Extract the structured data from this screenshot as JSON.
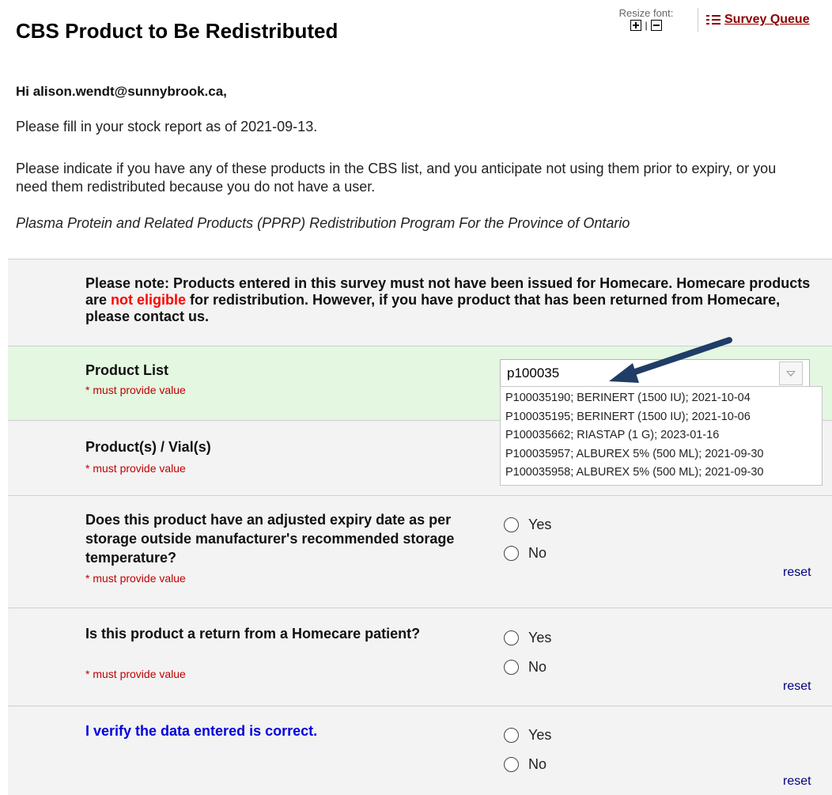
{
  "header": {
    "title": "CBS Product to Be Redistributed",
    "resize_font_label": "Resize font:",
    "resize_separator": "|",
    "survey_queue_label": "Survey Queue"
  },
  "intro": {
    "greeting": "Hi alison.wendt@sunnybrook.ca,",
    "fill_in": "Please fill in your stock report as of 2021-09-13.",
    "indicate": "Please indicate if you have any of these products in the CBS list, and you anticipate not using them prior to expiry, or you need them redistributed because you do not have a user.",
    "program": "Plasma Protein and Related Products (PPRP) Redistribution Program For the Province of Ontario"
  },
  "note": {
    "part1": "Please note: Products entered in this survey must not have been issued for Homecare. Homecare products are ",
    "highlight": "not eligible",
    "part2": " for redistribution. However, if you have product that has been returned from Homecare, please contact us."
  },
  "required_text": "* must provide value",
  "product_list": {
    "label": "Product List",
    "input_value": "p100035",
    "suggestions": [
      "P100035190; BERINERT (1500 IU); 2021-10-04",
      "P100035195; BERINERT (1500 IU); 2021-10-06",
      "P100035662; RIASTAP (1 G); 2023-01-16",
      "P100035957; ALBUREX 5% (500 ML); 2021-09-30",
      "P100035958; ALBUREX 5% (500 ML); 2021-09-30"
    ]
  },
  "vials": {
    "label": "Product(s) / Vial(s)"
  },
  "questions": {
    "expiry": "Does this product have an adjusted expiry date as per storage outside manufacturer's recommended storage temperature?",
    "homecare_return": "Is this product a return from a Homecare patient?",
    "verify": "I verify the data entered is correct."
  },
  "options": {
    "yes": "Yes",
    "no": "No",
    "reset": "reset"
  },
  "colors": {
    "accent": "#8b0000",
    "highlight": "#ff0000",
    "verify_text": "#0000e0",
    "arrow": "#1f3d66",
    "row_green": "#e3f7e1",
    "row_gray": "#f3f3f3"
  },
  "icons": {
    "survey_queue": "list-icon",
    "font_increase": "plus-square-icon",
    "font_decrease": "minus-square-icon",
    "dropdown": "triangle-down-icon"
  }
}
